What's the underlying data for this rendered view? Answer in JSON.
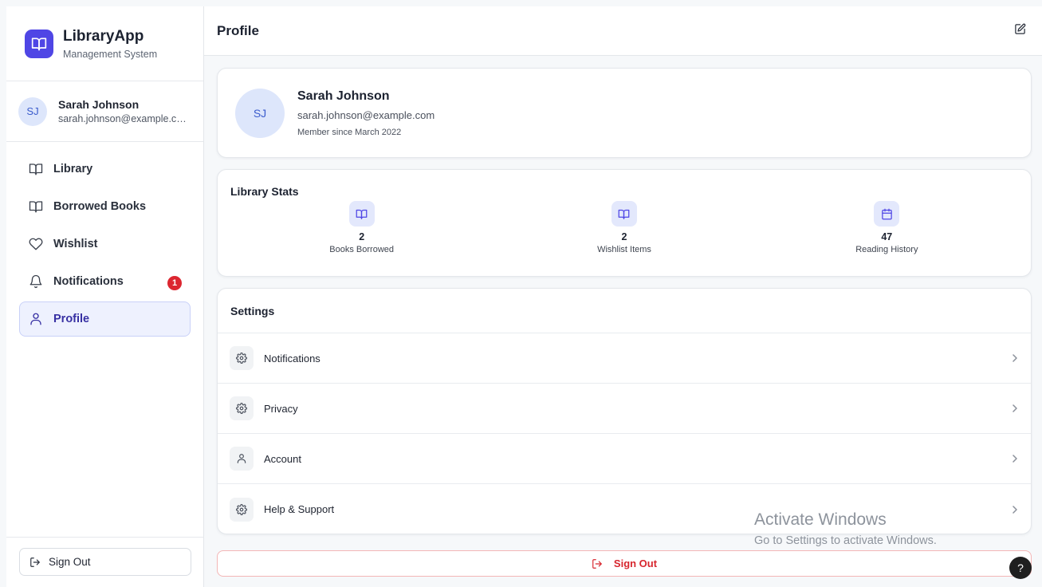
{
  "brand": {
    "name": "LibraryApp",
    "subtitle": "Management System",
    "color": "#4f46e5"
  },
  "user": {
    "initials": "SJ",
    "name": "Sarah Johnson",
    "email": "sarah.johnson@example.com"
  },
  "nav": [
    {
      "label": "Library",
      "icon": "book-open-icon"
    },
    {
      "label": "Borrowed Books",
      "icon": "book-open-icon"
    },
    {
      "label": "Wishlist",
      "icon": "heart-icon"
    },
    {
      "label": "Notifications",
      "icon": "bell-icon",
      "badge": "1"
    },
    {
      "label": "Profile",
      "icon": "user-icon",
      "active": true
    }
  ],
  "sidebar_signout": "Sign Out",
  "header": {
    "title": "Profile"
  },
  "profile": {
    "initials": "SJ",
    "name": "Sarah Johnson",
    "email": "sarah.johnson@example.com",
    "member_since": "Member since March 2022"
  },
  "stats": {
    "title": "Library Stats",
    "items": [
      {
        "value": "2",
        "label": "Books Borrowed",
        "icon": "book-open-icon"
      },
      {
        "value": "2",
        "label": "Wishlist Items",
        "icon": "book-open-icon"
      },
      {
        "value": "47",
        "label": "Reading History",
        "icon": "calendar-icon"
      }
    ]
  },
  "settings": {
    "title": "Settings",
    "items": [
      {
        "label": "Notifications",
        "icon": "gear-icon"
      },
      {
        "label": "Privacy",
        "icon": "gear-icon"
      },
      {
        "label": "Account",
        "icon": "user-icon"
      },
      {
        "label": "Help & Support",
        "icon": "gear-icon"
      }
    ]
  },
  "main_signout": "Sign Out",
  "watermark": {
    "title": "Activate Windows",
    "subtitle": "Go to Settings to activate Windows."
  },
  "help_fab": "?",
  "colors": {
    "accent": "#4f46e5",
    "danger": "#d7262e",
    "avatar_bg": "#dde6fb"
  }
}
